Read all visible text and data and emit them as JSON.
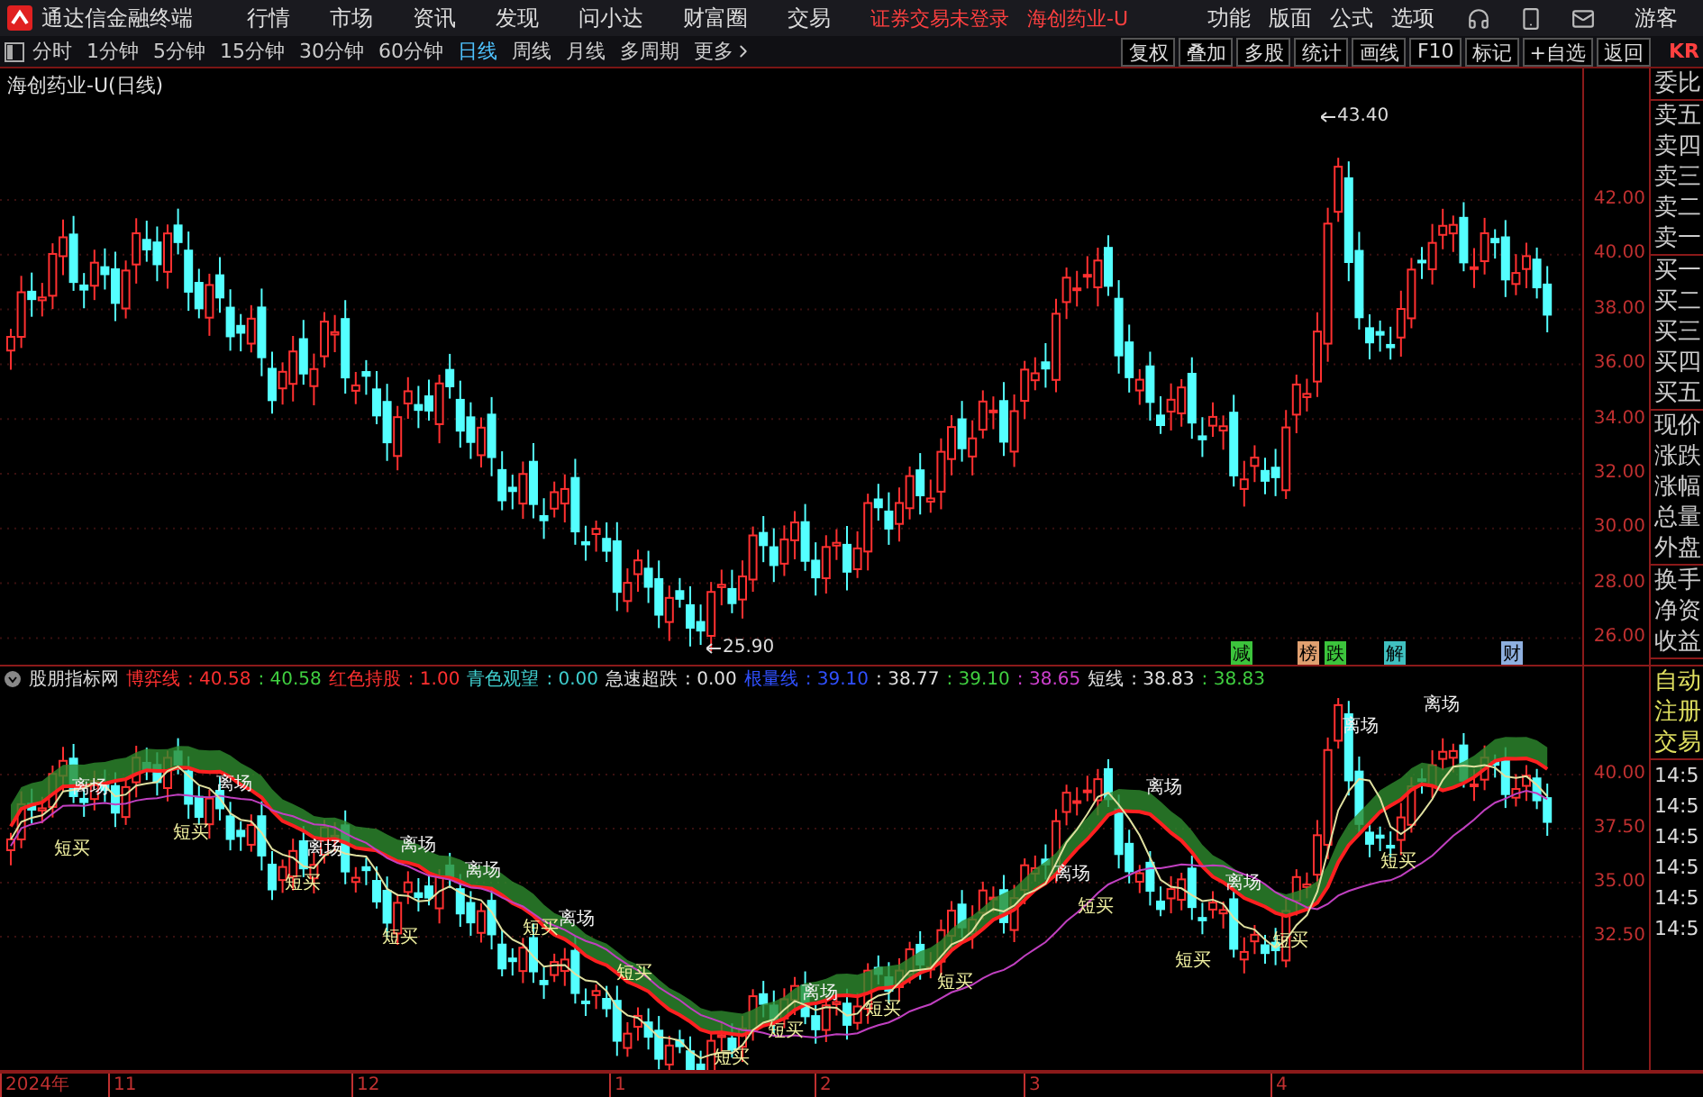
{
  "menu_bar": {
    "app_title": "通达信金融终端",
    "menus": [
      "行情",
      "市场",
      "资讯",
      "发现",
      "问小达",
      "财富圈",
      "交易"
    ],
    "login_status": "证券交易未登录",
    "stock_name": "海创药业-U",
    "tools": [
      "功能",
      "版面",
      "公式",
      "选项"
    ],
    "user": "游客"
  },
  "toolbar": {
    "periods": [
      {
        "label": "分时",
        "selected": false
      },
      {
        "label": "1分钟",
        "selected": false
      },
      {
        "label": "5分钟",
        "selected": false
      },
      {
        "label": "15分钟",
        "selected": false
      },
      {
        "label": "30分钟",
        "selected": false
      },
      {
        "label": "60分钟",
        "selected": false
      },
      {
        "label": "日线",
        "selected": true
      },
      {
        "label": "周线",
        "selected": false
      },
      {
        "label": "月线",
        "selected": false
      },
      {
        "label": "多周期",
        "selected": false
      },
      {
        "label": "更多",
        "selected": false
      }
    ],
    "actions": [
      "复权",
      "叠加",
      "多股",
      "统计",
      "画线",
      "F10",
      "标记",
      "+自选",
      "返回"
    ],
    "edge_label": "KR"
  },
  "main_chart": {
    "title": "海创药业-U(日线)",
    "price_axis": [
      "42.00",
      "40.00",
      "38.00",
      "36.00",
      "34.00",
      "32.00",
      "30.00",
      "28.00",
      "26.00"
    ],
    "high_marker": "43.40",
    "low_marker": "25.90",
    "signal_tags": [
      {
        "text": "减",
        "color": "#3cc43c"
      },
      {
        "text": "榜",
        "color": "#e0a070"
      },
      {
        "text": "跌",
        "color": "#3cc43c"
      },
      {
        "text": "解",
        "color": "#40c0c0"
      },
      {
        "text": "财",
        "color": "#8fb0e0"
      }
    ]
  },
  "quote_panel": {
    "groups": [
      [
        "委比"
      ],
      [
        "卖五",
        "卖四",
        "卖三",
        "卖二",
        "卖一"
      ],
      [
        "买一",
        "买二",
        "买三",
        "买四",
        "买五"
      ],
      [
        "现价",
        "涨跌",
        "涨幅",
        "总量",
        "外盘"
      ],
      [
        "换手",
        "净资",
        "收益"
      ]
    ]
  },
  "indicator": {
    "name": "股朋指标网",
    "legend": [
      {
        "label": "博弈线",
        "color": "#ff3030",
        "values": [
          {
            "text": ": 40.58",
            "color": "#ff3030"
          },
          {
            "text": ": 40.58",
            "color": "#40d040"
          }
        ]
      },
      {
        "label": "红色持股",
        "color": "#ff3030",
        "values": [
          {
            "text": ": 1.00",
            "color": "#ff3030"
          }
        ]
      },
      {
        "label": "青色观望",
        "color": "#40d0d0",
        "values": [
          {
            "text": ": 0.00",
            "color": "#40d0d0"
          }
        ]
      },
      {
        "label": "急速超跌",
        "color": "#e0e0e0",
        "values": [
          {
            "text": ": 0.00",
            "color": "#e0e0e0"
          }
        ]
      },
      {
        "label": "根量线",
        "color": "#3050ff",
        "values": [
          {
            "text": ": 39.10",
            "color": "#3050ff"
          },
          {
            "text": ": 38.77",
            "color": "#e0e0e0"
          },
          {
            "text": ": 39.10",
            "color": "#40d040"
          },
          {
            "text": ": 38.65",
            "color": "#d040d0"
          }
        ]
      },
      {
        "label": "短线",
        "color": "#e0e0e0",
        "values": [
          {
            "text": ": 38.83",
            "color": "#e0e0e0"
          },
          {
            "text": ": 38.83",
            "color": "#40d040"
          }
        ]
      }
    ],
    "signals": [
      {
        "kind": "exit",
        "text": "离场"
      },
      {
        "kind": "exit",
        "text": "离场"
      },
      {
        "kind": "exit",
        "text": "离场"
      },
      {
        "kind": "exit",
        "text": "离场"
      },
      {
        "kind": "exit",
        "text": "离场"
      },
      {
        "kind": "exit",
        "text": "离场"
      },
      {
        "kind": "exit",
        "text": "离场"
      },
      {
        "kind": "exit",
        "text": "离场"
      },
      {
        "kind": "exit",
        "text": "离场"
      },
      {
        "kind": "exit",
        "text": "离场"
      },
      {
        "kind": "exit",
        "text": "离场"
      },
      {
        "kind": "exit",
        "text": "离场"
      },
      {
        "kind": "buy",
        "text": "短买"
      },
      {
        "kind": "buy",
        "text": "短买"
      },
      {
        "kind": "buy",
        "text": "短买"
      },
      {
        "kind": "buy",
        "text": "短买"
      },
      {
        "kind": "buy",
        "text": "短买"
      },
      {
        "kind": "buy",
        "text": "短买"
      },
      {
        "kind": "buy",
        "text": "短买"
      },
      {
        "kind": "buy",
        "text": "短买"
      },
      {
        "kind": "buy",
        "text": "短买"
      },
      {
        "kind": "buy",
        "text": "短买"
      },
      {
        "kind": "buy",
        "text": "短买"
      },
      {
        "kind": "buy",
        "text": "短买"
      },
      {
        "kind": "buy",
        "text": "短买"
      },
      {
        "kind": "buy",
        "text": "短买"
      }
    ],
    "axis": [
      "40.00",
      "37.50",
      "35.00",
      "32.50"
    ]
  },
  "side_lower": {
    "tabs": [
      "自动",
      "注册",
      "交易"
    ],
    "times": [
      "14:5",
      "14:5",
      "14:5",
      "14:5",
      "14:5",
      "14:5"
    ]
  },
  "time_axis": [
    "2024年",
    "11",
    "12",
    "1",
    "2",
    "3",
    "4"
  ]
}
